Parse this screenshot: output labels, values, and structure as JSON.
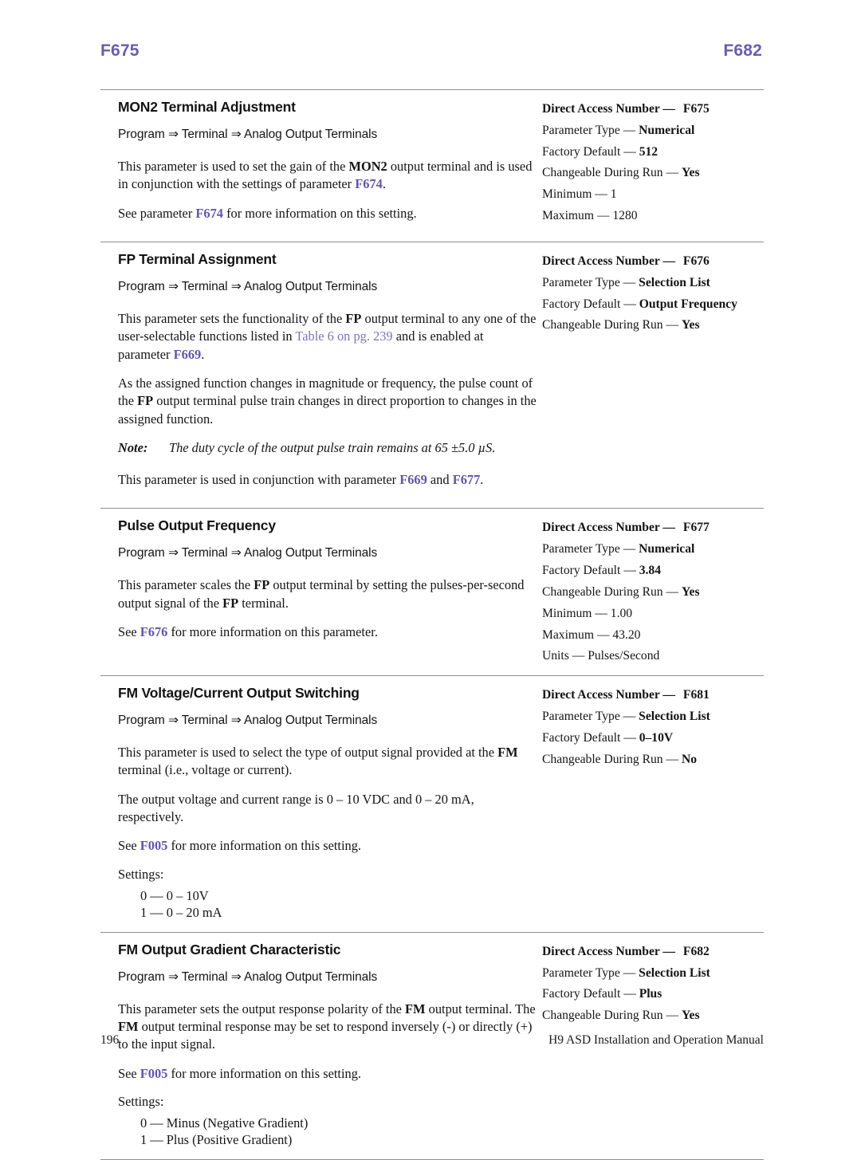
{
  "running_head": {
    "left": "F675",
    "right": "F682",
    "color": "#6a5caf"
  },
  "footer": {
    "page_number": "196",
    "manual_title": "H9 ASD Installation and Operation Manual"
  },
  "spec_labels": {
    "direct_access_number": "Direct Access Number —",
    "parameter_type": "Parameter Type —",
    "factory_default": "Factory Default —",
    "changeable_during_run": "Changeable During Run —",
    "minimum": "Minimum —",
    "maximum": "Maximum —",
    "units": "Units —"
  },
  "common": {
    "nav_path": "Program ⇒ Terminal ⇒ Analog Output Terminals",
    "settings_label": "Settings:"
  },
  "sections": [
    {
      "title": "MON2 Terminal Adjustment",
      "path": "Program ⇒ Terminal ⇒ Analog Output Terminals",
      "paragraphs": [
        {
          "parts": [
            {
              "t": "This parameter is used to set the gain of the ",
              "s": "n"
            },
            {
              "t": "MON2",
              "s": "b"
            },
            {
              "t": " output terminal and is used in conjunction with the settings of parameter ",
              "s": "n"
            },
            {
              "t": "F674",
              "s": "link"
            },
            {
              "t": ".",
              "s": "n"
            }
          ]
        },
        {
          "parts": [
            {
              "t": "See parameter ",
              "s": "n"
            },
            {
              "t": "F674",
              "s": "link"
            },
            {
              "t": " for more information on this setting.",
              "s": "n"
            }
          ]
        }
      ],
      "specs": [
        {
          "label": "Direct Access Number —",
          "value": "F675",
          "bold_label": true,
          "bold_value": true
        },
        {
          "label": "Parameter Type —",
          "value": "Numerical",
          "bold_label": false,
          "bold_value": true
        },
        {
          "label": "Factory Default —",
          "value": "512",
          "bold_label": false,
          "bold_value": true
        },
        {
          "label": "Changeable During Run —",
          "value": "Yes",
          "bold_label": false,
          "bold_value": true
        },
        {
          "label": "Minimum —",
          "value": "1",
          "bold_label": false,
          "bold_value": false
        },
        {
          "label": "Maximum —",
          "value": "1280",
          "bold_label": false,
          "bold_value": false
        }
      ]
    },
    {
      "title": "FP Terminal Assignment",
      "path": "Program ⇒ Terminal ⇒ Analog Output Terminals",
      "paragraphs": [
        {
          "parts": [
            {
              "t": "This parameter sets the functionality of the ",
              "s": "n"
            },
            {
              "t": "FP",
              "s": "b"
            },
            {
              "t": " output terminal to any one of the user-selectable functions listed in ",
              "s": "n"
            },
            {
              "t": "Table 6 on pg. 239",
              "s": "link-plain"
            },
            {
              "t": " and is enabled at parameter ",
              "s": "n"
            },
            {
              "t": "F669",
              "s": "link"
            },
            {
              "t": ".",
              "s": "n"
            }
          ]
        },
        {
          "parts": [
            {
              "t": "As the assigned function changes in magnitude or frequency, the pulse count of the ",
              "s": "n"
            },
            {
              "t": "FP",
              "s": "b"
            },
            {
              "t": " output terminal pulse train changes in direct proportion to changes in the assigned function.",
              "s": "n"
            }
          ]
        }
      ],
      "note": {
        "label": "Note:",
        "text": "The duty cycle of the output pulse train remains at 65 ±5.0 µS."
      },
      "paragraphs_after_note": [
        {
          "parts": [
            {
              "t": "This parameter is used in conjunction with parameter ",
              "s": "n"
            },
            {
              "t": "F669",
              "s": "link"
            },
            {
              "t": " and ",
              "s": "n"
            },
            {
              "t": "F677",
              "s": "link"
            },
            {
              "t": ".",
              "s": "n"
            }
          ]
        }
      ],
      "specs": [
        {
          "label": "Direct Access Number —",
          "value": "F676",
          "bold_label": true,
          "bold_value": true
        },
        {
          "label": "Parameter Type —",
          "value": "Selection List",
          "bold_label": false,
          "bold_value": true
        },
        {
          "label": "Factory Default —",
          "value": "Output Frequency",
          "bold_label": false,
          "bold_value": true
        },
        {
          "label": "Changeable During Run —",
          "value": "Yes",
          "bold_label": false,
          "bold_value": true
        }
      ]
    },
    {
      "title": "Pulse Output Frequency",
      "path": "Program ⇒ Terminal ⇒ Analog Output Terminals",
      "paragraphs": [
        {
          "parts": [
            {
              "t": "This parameter scales the ",
              "s": "n"
            },
            {
              "t": "FP",
              "s": "b"
            },
            {
              "t": " output terminal by setting the pulses-per-second output signal of the ",
              "s": "n"
            },
            {
              "t": "FP",
              "s": "b"
            },
            {
              "t": " terminal.",
              "s": "n"
            }
          ]
        },
        {
          "parts": [
            {
              "t": "See ",
              "s": "n"
            },
            {
              "t": "F676",
              "s": "link"
            },
            {
              "t": " for more information on this parameter.",
              "s": "n"
            }
          ]
        }
      ],
      "specs": [
        {
          "label": "Direct Access Number —",
          "value": "F677",
          "bold_label": true,
          "bold_value": true
        },
        {
          "label": "Parameter Type —",
          "value": "Numerical",
          "bold_label": false,
          "bold_value": true
        },
        {
          "label": "Factory Default —",
          "value": "3.84",
          "bold_label": false,
          "bold_value": true
        },
        {
          "label": "Changeable During Run —",
          "value": "Yes",
          "bold_label": false,
          "bold_value": true
        },
        {
          "label": "Minimum —",
          "value": "1.00",
          "bold_label": false,
          "bold_value": false
        },
        {
          "label": "Maximum —",
          "value": "43.20",
          "bold_label": false,
          "bold_value": false
        },
        {
          "label": "Units —",
          "value": "Pulses/Second",
          "bold_label": false,
          "bold_value": false
        }
      ]
    },
    {
      "title": "FM Voltage/Current Output Switching",
      "path": "Program ⇒ Terminal ⇒ Analog Output Terminals",
      "paragraphs": [
        {
          "parts": [
            {
              "t": "This parameter is used to select the type of output signal provided at the ",
              "s": "n"
            },
            {
              "t": "FM",
              "s": "b"
            },
            {
              "t": " terminal (i.e., voltage or current).",
              "s": "n"
            }
          ]
        },
        {
          "parts": [
            {
              "t": "The output voltage and current range is 0 – 10 VDC and 0 – 20 mA, respectively.",
              "s": "n"
            }
          ]
        },
        {
          "parts": [
            {
              "t": "See ",
              "s": "n"
            },
            {
              "t": "F005",
              "s": "link"
            },
            {
              "t": " for more information on this setting.",
              "s": "n"
            }
          ]
        }
      ],
      "settings_label": "Settings:",
      "settings": [
        "0 — 0 – 10V",
        "1 — 0 – 20 mA"
      ],
      "specs": [
        {
          "label": "Direct Access Number —",
          "value": "F681",
          "bold_label": true,
          "bold_value": true
        },
        {
          "label": "Parameter Type —",
          "value": "Selection List",
          "bold_label": false,
          "bold_value": true
        },
        {
          "label": "Factory Default —",
          "value": "0–10V",
          "bold_label": false,
          "bold_value": true
        },
        {
          "label": "Changeable During Run —",
          "value": "No",
          "bold_label": false,
          "bold_value": true
        }
      ]
    },
    {
      "title": "FM Output Gradient Characteristic",
      "path": "Program ⇒ Terminal ⇒ Analog Output Terminals",
      "paragraphs": [
        {
          "parts": [
            {
              "t": "This parameter sets the output response polarity of the ",
              "s": "n"
            },
            {
              "t": "FM",
              "s": "b"
            },
            {
              "t": " output terminal. The ",
              "s": "n"
            },
            {
              "t": "FM",
              "s": "b"
            },
            {
              "t": " output terminal response may be set to respond inversely (-) or directly (+) to the input signal.",
              "s": "n"
            }
          ]
        },
        {
          "parts": [
            {
              "t": "See ",
              "s": "n"
            },
            {
              "t": "F005",
              "s": "link"
            },
            {
              "t": " for more information on this setting.",
              "s": "n"
            }
          ]
        }
      ],
      "settings_label": "Settings:",
      "settings": [
        "0 — Minus (Negative Gradient)",
        "1 — Plus (Positive Gradient)"
      ],
      "specs": [
        {
          "label": "Direct Access Number —",
          "value": "F682",
          "bold_label": true,
          "bold_value": true
        },
        {
          "label": "Parameter Type —",
          "value": "Selection List",
          "bold_label": false,
          "bold_value": true
        },
        {
          "label": "Factory Default —",
          "value": "Plus",
          "bold_label": false,
          "bold_value": true
        },
        {
          "label": "Changeable During Run —",
          "value": "Yes",
          "bold_label": false,
          "bold_value": true
        }
      ]
    }
  ]
}
